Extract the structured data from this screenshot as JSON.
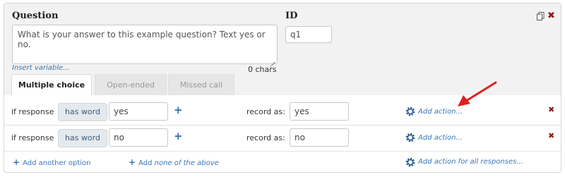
{
  "question": {
    "label": "Question",
    "text": "What is your answer to this example question? Text yes or no.",
    "insert_variable": "Insert variable...",
    "char_count": "0 chars"
  },
  "id_field": {
    "label": "ID",
    "value": "q1"
  },
  "tabs": [
    {
      "label": "Multiple choice",
      "active": true
    },
    {
      "label": "Open-ended",
      "active": false
    },
    {
      "label": "Missed call",
      "active": false
    }
  ],
  "options": [
    {
      "prefix": "if response",
      "match_type": "has word",
      "keyword": "yes",
      "record_label": "record as:",
      "record_value": "yes",
      "action_label": "Add action..."
    },
    {
      "prefix": "if response",
      "match_type": "has word",
      "keyword": "no",
      "record_label": "record as:",
      "record_value": "no",
      "action_label": "Add action..."
    }
  ],
  "footer": {
    "add_option": "Add another option",
    "add_none_prefix": "Add",
    "add_none_rest": "none of the above",
    "add_all": "Add action for all responses..."
  },
  "icons": {
    "plus": "+",
    "remove": "✖",
    "copy": "copy-icon",
    "gear": "gear-icon"
  },
  "colors": {
    "link": "#3b77b5",
    "remove": "#8b1a1a",
    "annotation_arrow": "#e02020"
  }
}
